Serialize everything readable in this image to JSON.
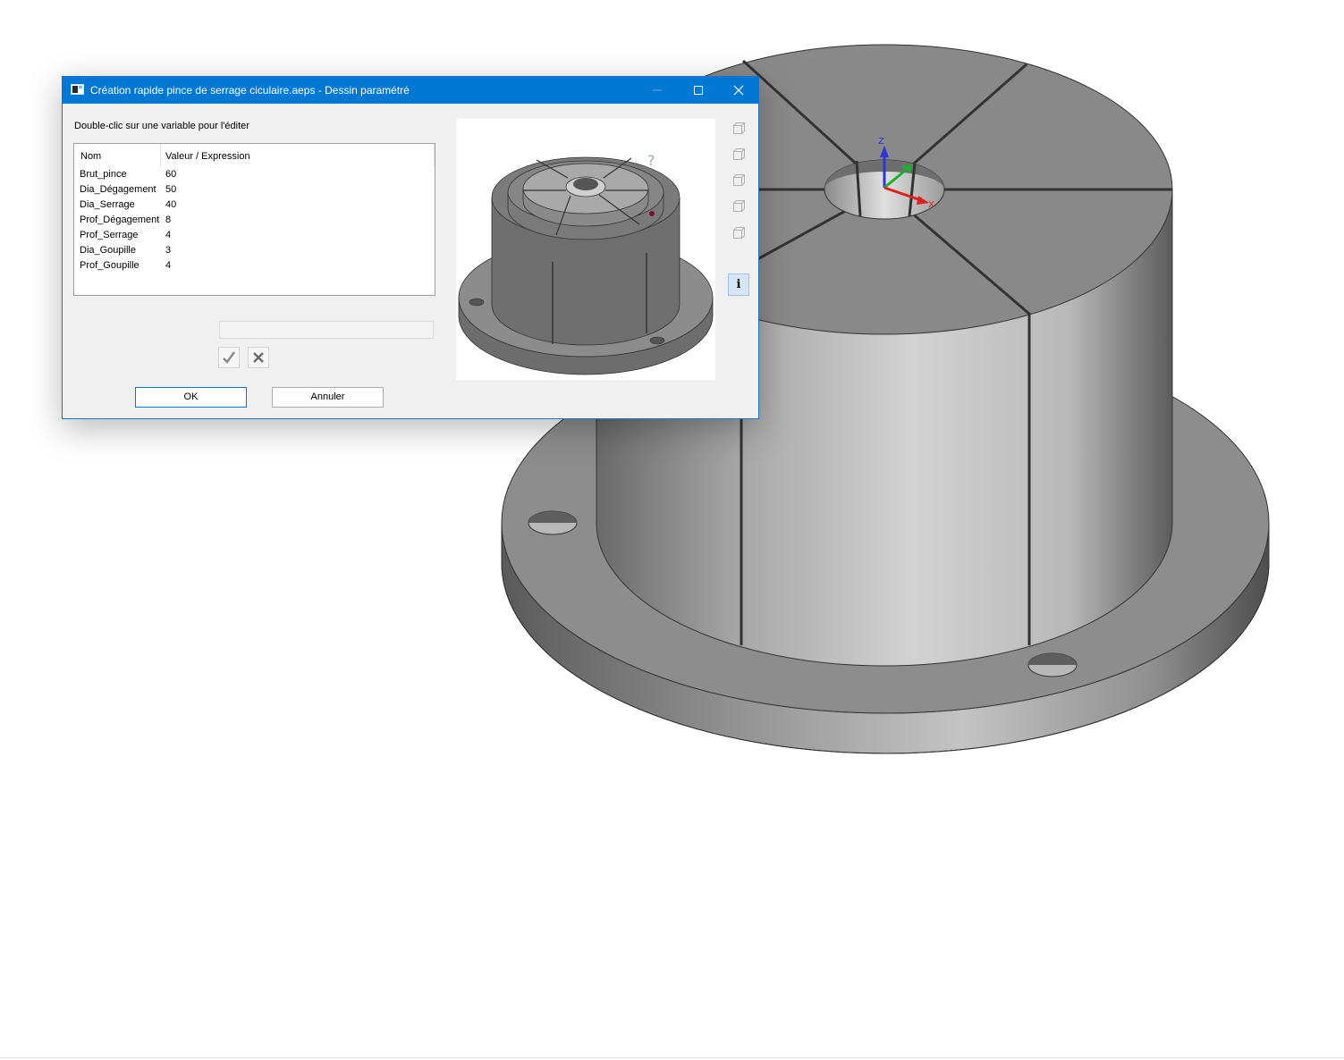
{
  "dialog": {
    "title": "Création rapide pince de serrage ciculaire.aeps - Dessin paramétré",
    "hint": "Double-clic sur une variable pour l'éditer",
    "table": {
      "columns": [
        "Nom",
        "Valeur / Expression"
      ],
      "rows": [
        {
          "name": "Brut_pince",
          "value": "60"
        },
        {
          "name": "Dia_Dégagement",
          "value": "50"
        },
        {
          "name": "Dia_Serrage",
          "value": "40"
        },
        {
          "name": "Prof_Dégagement",
          "value": "8"
        },
        {
          "name": "Prof_Serrage",
          "value": "4"
        },
        {
          "name": "Dia_Goupille",
          "value": "3"
        },
        {
          "name": "Prof_Goupille",
          "value": "4"
        }
      ]
    },
    "expression_value": "",
    "buttons": {
      "ok": "OK",
      "cancel": "Annuler"
    },
    "info_label": "i",
    "preview_help_mark": "?"
  },
  "viewport": {
    "axis_labels": {
      "z": "Z",
      "x": "X"
    },
    "axis_colors": {
      "z": "#2b36d8",
      "x": "#e02020",
      "y": "#19b32e"
    },
    "title_bar_color": "#0078d4"
  },
  "icons": [
    "app-icon",
    "minimize-icon",
    "maximize-icon",
    "close-icon",
    "check-icon",
    "cross-icon",
    "view-cube-icon",
    "info-icon"
  ]
}
